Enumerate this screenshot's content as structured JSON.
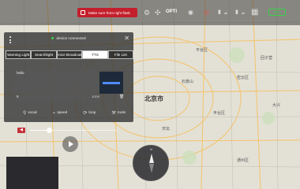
{
  "map": {
    "city_label": "北京市",
    "labels": [
      "平谷区",
      "密云区",
      "回子营",
      "天坛",
      "大兴",
      "通州区",
      "石景山",
      "丰台区"
    ]
  },
  "status_bar": {
    "warning_text": "Make sure from right flask",
    "mode": "OPTI",
    "battery": "86%"
  },
  "panel": {
    "connection_status": "device connected",
    "tabs": [
      "Warning Light",
      "SearchlIght",
      "Voice Broadcast",
      "TTS",
      "File List"
    ],
    "active_tab": "TTS",
    "tts_text": "hello",
    "char_count": "5",
    "side_label": "1/200",
    "actions": {
      "vocal": "vocal",
      "speed": "speed",
      "loop": "loop",
      "tools": "tools"
    }
  },
  "volume": {
    "level": 0.22,
    "max_label": "100"
  },
  "colors": {
    "accent_green": "#3bd14a",
    "warning_red": "#c41f2c"
  }
}
